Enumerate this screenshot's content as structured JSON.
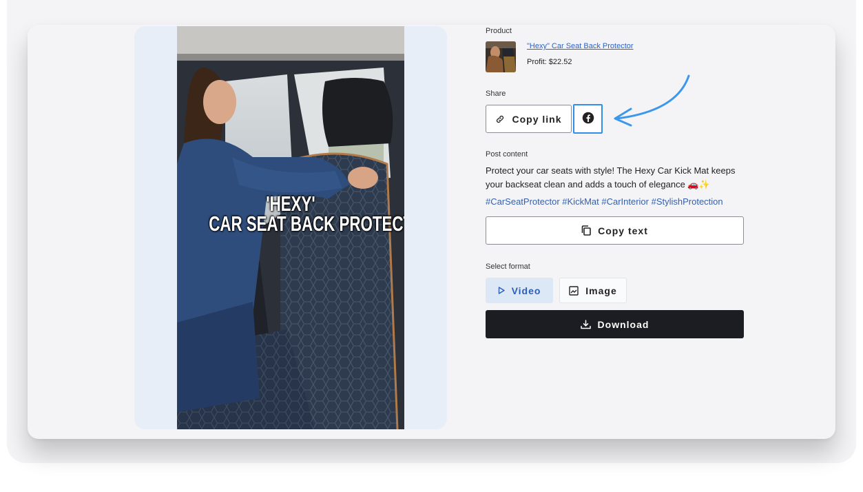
{
  "overlay": {
    "line1": "'HEXY'",
    "line2": "CAR SEAT BACK PROTECTOR"
  },
  "product": {
    "section_label": "Product",
    "link_text": "\"Hexy\" Car Seat Back Protector",
    "profit_label": "Profit:",
    "profit_value": "$22.52"
  },
  "share": {
    "section_label": "Share",
    "copy_link_label": "Copy link",
    "facebook_icon": "facebook-icon"
  },
  "post": {
    "section_label": "Post content",
    "text": "Protect your car seats with style! The Hexy Car Kick Mat keeps your backseat clean and adds a touch of elegance 🚗✨",
    "hashtags": "#CarSeatProtector #KickMat #CarInterior #StylishProtection",
    "copy_text_label": "Copy text"
  },
  "format": {
    "section_label": "Select format",
    "options": [
      "Video",
      "Image"
    ],
    "selected": "Video"
  },
  "download_label": "Download",
  "colors": {
    "accent_blue": "#2f8ee8",
    "link": "#2a62c9",
    "hashtag": "#3560a8",
    "selected_bg": "#dce8f6",
    "download_bg": "#1b1d22"
  }
}
